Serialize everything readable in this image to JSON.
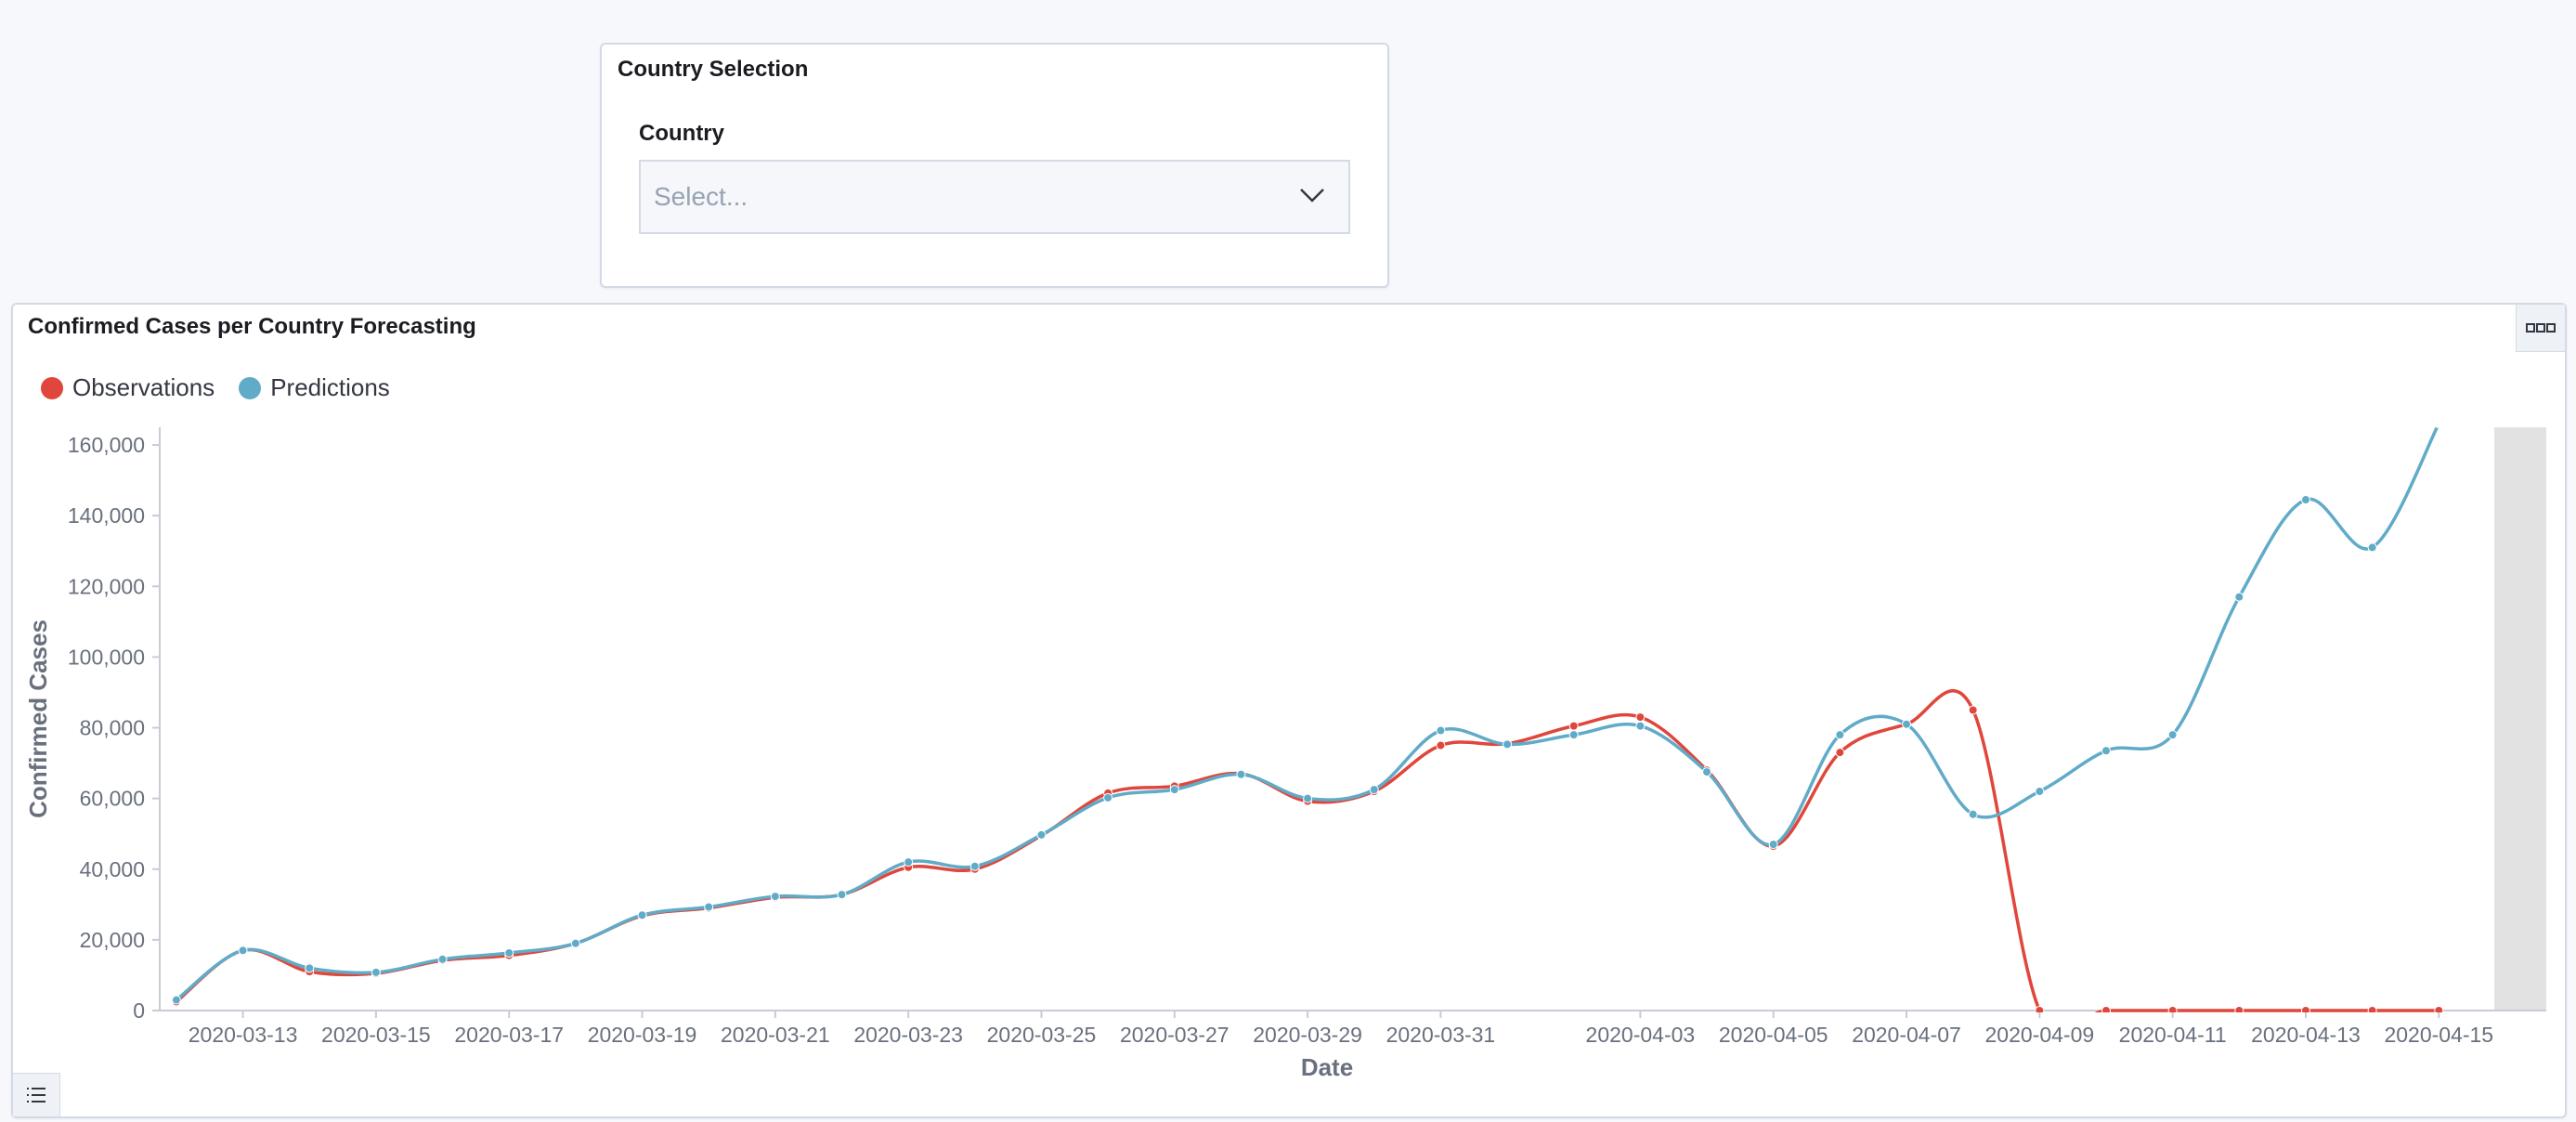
{
  "country_panel": {
    "title": "Country Selection",
    "field_label": "Country",
    "placeholder": "Select..."
  },
  "chart_panel": {
    "title": "Confirmed Cases per Country Forecasting"
  },
  "colors": {
    "observations": "#e0463b",
    "predictions": "#60abc8",
    "end_band": "#e2e2e2"
  },
  "chart_data": {
    "type": "line",
    "title": "Confirmed Cases per Country Forecasting",
    "xlabel": "Date",
    "ylabel": "Confirmed Cases",
    "ylim": [
      0,
      165000
    ],
    "xlim": [
      "2020-03-11T18:00",
      "2020-04-15T20:00"
    ],
    "yticks": [
      0,
      20000,
      40000,
      60000,
      80000,
      100000,
      120000,
      140000,
      160000
    ],
    "ytick_labels": [
      "0",
      "20,000",
      "40,000",
      "60,000",
      "80,000",
      "100,000",
      "120,000",
      "140,000",
      "160,000"
    ],
    "xtick_labels": [
      "2020-03-13",
      "2020-03-15",
      "2020-03-17",
      "2020-03-19",
      "2020-03-21",
      "2020-03-23",
      "2020-03-25",
      "2020-03-27",
      "2020-03-29",
      "2020-03-31",
      "2020-04-03",
      "2020-04-05",
      "2020-04-07",
      "2020-04-09",
      "2020-04-11",
      "2020-04-13",
      "2020-04-15"
    ],
    "legend": "top-left",
    "grid": false,
    "series": [
      {
        "name": "Observations",
        "points": [
          [
            "2020-03-12",
            2500
          ],
          [
            "2020-03-13",
            17000
          ],
          [
            "2020-03-14",
            11000
          ],
          [
            "2020-03-15",
            10500
          ],
          [
            "2020-03-16",
            14200
          ],
          [
            "2020-03-17",
            15600
          ],
          [
            "2020-03-18",
            19000
          ],
          [
            "2020-03-19",
            26800
          ],
          [
            "2020-03-20",
            29000
          ],
          [
            "2020-03-21",
            32000
          ],
          [
            "2020-03-22",
            32800
          ],
          [
            "2020-03-23",
            40500
          ],
          [
            "2020-03-24",
            40000
          ],
          [
            "2020-03-25",
            49500
          ],
          [
            "2020-03-26",
            61500
          ],
          [
            "2020-03-27",
            63500
          ],
          [
            "2020-03-28",
            67000
          ],
          [
            "2020-03-29",
            59200
          ],
          [
            "2020-03-30",
            62000
          ],
          [
            "2020-03-31",
            75000
          ],
          [
            "2020-04-01",
            75500
          ],
          [
            "2020-04-02",
            80500
          ],
          [
            "2020-04-03",
            83000
          ],
          [
            "2020-04-04",
            68000
          ],
          [
            "2020-04-05",
            46500
          ],
          [
            "2020-04-06",
            73000
          ],
          [
            "2020-04-07",
            81000
          ],
          [
            "2020-04-08",
            85000
          ],
          [
            "2020-04-09",
            0
          ],
          [
            "2020-04-10",
            0
          ],
          [
            "2020-04-11",
            0
          ],
          [
            "2020-04-12",
            0
          ],
          [
            "2020-04-13",
            0
          ],
          [
            "2020-04-14",
            0
          ],
          [
            "2020-04-15",
            0
          ]
        ]
      },
      {
        "name": "Predictions",
        "points": [
          [
            "2020-03-12",
            3000
          ],
          [
            "2020-03-13",
            17000
          ],
          [
            "2020-03-14",
            12000
          ],
          [
            "2020-03-15",
            10800
          ],
          [
            "2020-03-16",
            14500
          ],
          [
            "2020-03-17",
            16300
          ],
          [
            "2020-03-18",
            19000
          ],
          [
            "2020-03-19",
            27000
          ],
          [
            "2020-03-20",
            29300
          ],
          [
            "2020-03-21",
            32300
          ],
          [
            "2020-03-22",
            32800
          ],
          [
            "2020-03-23",
            42000
          ],
          [
            "2020-03-24",
            40800
          ],
          [
            "2020-03-25",
            49700
          ],
          [
            "2020-03-26",
            60200
          ],
          [
            "2020-03-27",
            62500
          ],
          [
            "2020-03-28",
            66800
          ],
          [
            "2020-03-29",
            60000
          ],
          [
            "2020-03-30",
            62500
          ],
          [
            "2020-03-31",
            79200
          ],
          [
            "2020-04-01",
            75300
          ],
          [
            "2020-04-02",
            78000
          ],
          [
            "2020-04-03",
            80500
          ],
          [
            "2020-04-04",
            67500
          ],
          [
            "2020-04-05",
            47000
          ],
          [
            "2020-04-06",
            78000
          ],
          [
            "2020-04-07",
            81000
          ],
          [
            "2020-04-08",
            55500
          ],
          [
            "2020-04-09",
            62000
          ],
          [
            "2020-04-10",
            73500
          ],
          [
            "2020-04-11",
            78000
          ],
          [
            "2020-04-12",
            117000
          ],
          [
            "2020-04-13",
            144500
          ],
          [
            "2020-04-14",
            131000
          ],
          [
            "2020-04-15",
            166000
          ]
        ]
      }
    ]
  }
}
